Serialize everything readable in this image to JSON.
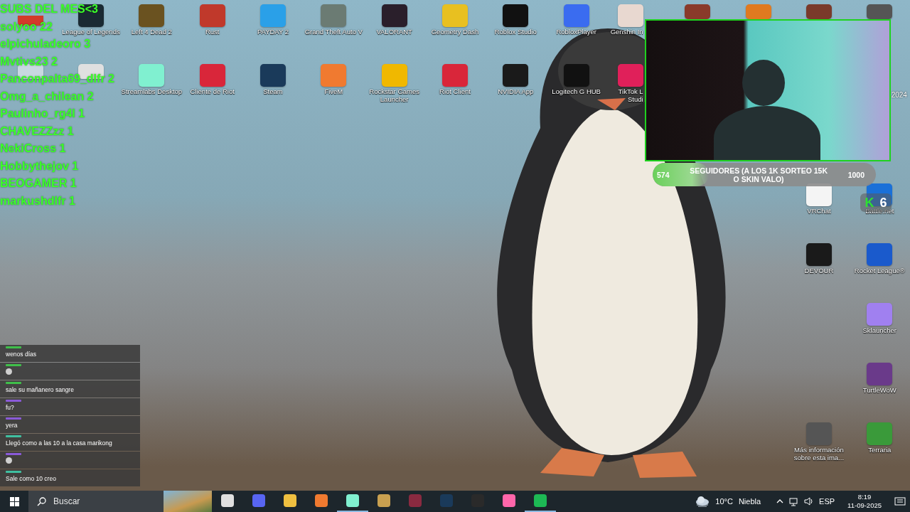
{
  "desktop": {
    "top_rows": [
      [
        {
          "color": "#d33a2a"
        },
        {
          "label": "League of Legends",
          "color": "#1a2a33"
        },
        {
          "label": "Left 4 Dead 2",
          "color": "#6a5220"
        },
        {
          "label": "Rust",
          "color": "#c0392b"
        },
        {
          "label": "PAYDAY 2",
          "color": "#2aa0e8"
        },
        {
          "label": "Grand Theft Auto V",
          "color": "#6b7b73"
        },
        {
          "label": "VALORANT",
          "color": "#2a1f2b"
        },
        {
          "label": "Geometry Dash",
          "color": "#e8c020"
        },
        {
          "label": "Roblox Studio",
          "color": "#111111"
        },
        {
          "label": "RobloxPlayer",
          "color": "#3a6cf0"
        },
        {
          "label": "Genshin In",
          "color": "#e8d8d0"
        },
        {
          "color": "#8a3a2a"
        },
        {
          "color": "#e07a20"
        },
        {
          "color": "#7a3a2a"
        },
        {
          "color": "#555555"
        }
      ],
      [
        {
          "color": "#c8d8e0"
        },
        {
          "color": "#e0e0e0"
        },
        {
          "label": "Streamlabs Desktop",
          "color": "#80f0d0"
        },
        {
          "label": "Cliente de Riot",
          "color": "#d9263a"
        },
        {
          "label": "Steam",
          "color": "#1a3a5a"
        },
        {
          "label": "FiveM",
          "color": "#f07a30"
        },
        {
          "label": "Rockstar Games Launcher",
          "color": "#f0b800"
        },
        {
          "label": "Riot Client",
          "color": "#d9263a"
        },
        {
          "label": "NVIDIA App",
          "color": "#1a1a1a"
        },
        {
          "label": "Logitech G HUB",
          "color": "#111111"
        },
        {
          "label": "TikTok L Studi",
          "color": "#e0205a"
        }
      ]
    ],
    "edge_label": "2024",
    "right_rows": [
      [
        {
          "label": "VRChat",
          "color": "#f4f4f4"
        },
        {
          "label": "Battle.net",
          "color": "#1a70d8"
        }
      ],
      [
        {
          "label": "DEVOUR",
          "color": "#1a1a1a"
        },
        {
          "label": "Rocket League®",
          "color": "#1a5acc"
        }
      ],
      [
        {
          "label": "Sklauncher",
          "color": "#a080f0"
        }
      ],
      [
        {
          "label": "TurtleWoW",
          "color": "#6a3a8a"
        }
      ],
      [
        {
          "label": "Más información sobre esta ima...",
          "color": "#555555"
        },
        {
          "label": "Terraria",
          "color": "#3a9a3a"
        }
      ]
    ]
  },
  "overlay": {
    "title": "SUBS DEL MES<3",
    "subs": [
      "solyoo 22",
      "elpichuladeoro 3",
      "Mvtivs23 2",
      "Panconpalta69_dlfr 2",
      "Omg_a_chilean 2",
      "Paulinho_rg4l 1",
      "CHAVEZZzz 1",
      "NekiCross 1",
      "Hobbythejov 1",
      "BEOGAMER 1",
      "markushdlfr 1"
    ]
  },
  "follower_goal": {
    "current": "574",
    "title": "SEGUIDORES (A LOS 1K SORTEO 15K O SKIN VALO)",
    "target": "1000",
    "level": 0.25
  },
  "kick_badge": {
    "letter": "K",
    "count": "6"
  },
  "chat": [
    {
      "color": "#3fbf4a",
      "kind": "text",
      "text": "wenos días"
    },
    {
      "color": "#3fbf4a",
      "kind": "emote"
    },
    {
      "color": "#3fbf4a",
      "kind": "text",
      "text": "sale su mañanero sangre"
    },
    {
      "color": "#8a5ad8",
      "kind": "text",
      "text": "fu?"
    },
    {
      "color": "#8a5ad8",
      "kind": "text",
      "text": "yera"
    },
    {
      "color": "#3fbfa0",
      "kind": "text",
      "text": "Llegó como a las 10 a la casa marikong"
    },
    {
      "color": "#8a5ad8",
      "kind": "emote"
    },
    {
      "color": "#3fbfa0",
      "kind": "text",
      "text": "Sale como 10 creo"
    }
  ],
  "taskbar": {
    "search": {
      "placeholder": "Buscar"
    },
    "apps": [
      {
        "color": "#e0e0e0",
        "running": false
      },
      {
        "color": "#5865f2",
        "running": false
      },
      {
        "color": "#f0c040",
        "running": false
      },
      {
        "color": "#f07a30",
        "running": false
      },
      {
        "color": "#80f0d0",
        "running": true
      },
      {
        "color": "#c8a050",
        "running": false
      },
      {
        "color": "#8a2a40",
        "running": false
      },
      {
        "color": "#1a3a5a",
        "running": false
      },
      {
        "color": "#2a2a2a",
        "running": false
      },
      {
        "color": "#ff66aa",
        "running": false
      },
      {
        "color": "#1db954",
        "running": true
      }
    ],
    "weather": {
      "temp": "10°C",
      "condition": "Niebla"
    },
    "language": "ESP",
    "time": "8:19",
    "date": "11-09-2025"
  }
}
